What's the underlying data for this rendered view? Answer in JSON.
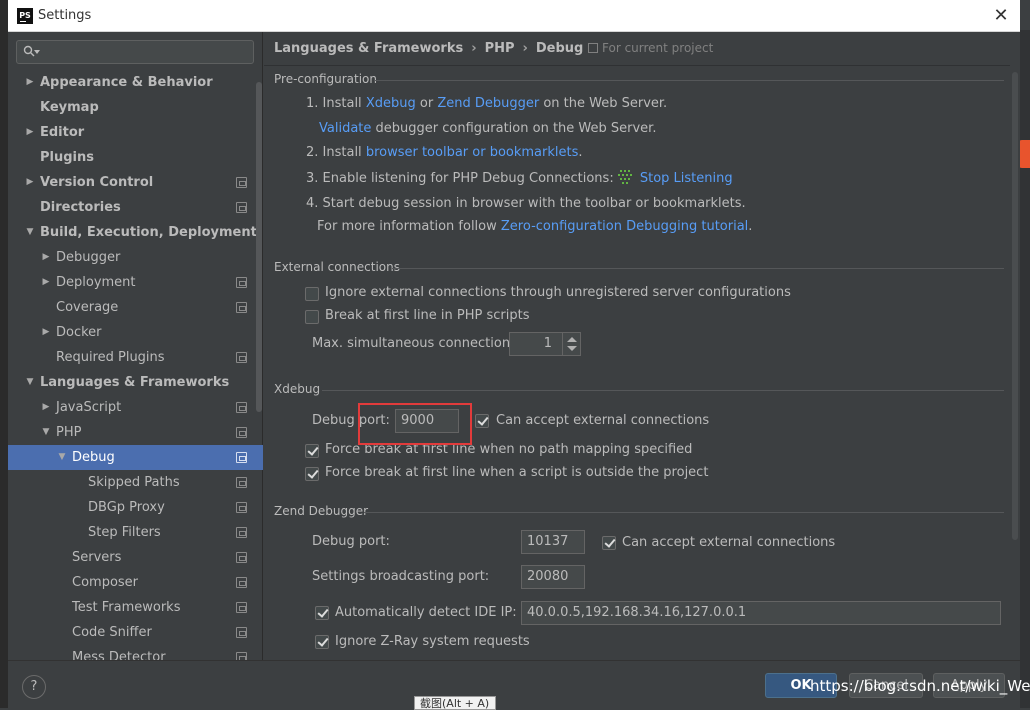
{
  "window": {
    "title": "Settings",
    "app_icon": "PS"
  },
  "search": {
    "placeholder": ""
  },
  "tree": [
    {
      "label": "Appearance & Behavior",
      "bold": true,
      "expander": "right"
    },
    {
      "label": "Keymap",
      "bold": true
    },
    {
      "label": "Editor",
      "bold": true,
      "expander": "right"
    },
    {
      "label": "Plugins",
      "bold": true
    },
    {
      "label": "Version Control",
      "bold": true,
      "expander": "right",
      "project": true
    },
    {
      "label": "Directories",
      "bold": true,
      "project": true
    },
    {
      "label": "Build, Execution, Deployment",
      "bold": true,
      "expander": "down"
    },
    {
      "label": "Debugger",
      "expander": "right"
    },
    {
      "label": "Deployment",
      "expander": "right",
      "project": true
    },
    {
      "label": "Coverage",
      "project": true
    },
    {
      "label": "Docker",
      "expander": "right"
    },
    {
      "label": "Required Plugins",
      "project": true
    },
    {
      "label": "Languages & Frameworks",
      "bold": true,
      "expander": "down"
    },
    {
      "label": "JavaScript",
      "expander": "right",
      "project": true
    },
    {
      "label": "PHP",
      "expander": "down",
      "project": true
    },
    {
      "label": "Debug",
      "expander": "down",
      "project": true,
      "selected": true
    },
    {
      "label": "Skipped Paths",
      "project": true
    },
    {
      "label": "DBGp Proxy",
      "project": true
    },
    {
      "label": "Step Filters",
      "project": true
    },
    {
      "label": "Servers",
      "project": true
    },
    {
      "label": "Composer",
      "project": true
    },
    {
      "label": "Test Frameworks",
      "project": true
    },
    {
      "label": "Code Sniffer",
      "project": true
    },
    {
      "label": "Mess Detector",
      "project": true
    }
  ],
  "breadcrumb": {
    "items": [
      "Languages & Frameworks",
      "PHP",
      "Debug"
    ],
    "separator": "›",
    "scope": "For current project"
  },
  "preconfig": {
    "title": "Pre-configuration",
    "step1_num": "1. Install",
    "xdebug": "Xdebug",
    "or": "or",
    "zend_debugger": "Zend Debugger",
    "on_server": "on the Web Server.",
    "validate": "Validate",
    "validate_rest": "debugger configuration on the Web Server.",
    "step2_num": "2. Install",
    "browser_toolbar": "browser toolbar or bookmarklets",
    "step2_dot": ".",
    "step3": "3. Enable listening for PHP Debug Connections:",
    "stop_listening": "Stop Listening",
    "step4": "4. Start debug session in browser with the toolbar or bookmarklets.",
    "more_info": "For more information follow",
    "tutorial": "Zero-configuration Debugging tutorial",
    "tutorial_dot": "."
  },
  "external": {
    "title": "External connections",
    "ignore_label": "Ignore external connections through unregistered server configurations",
    "ignore_checked": false,
    "break_label": "Break at first line in PHP scripts",
    "break_checked": false,
    "max_label": "Max. simultaneous connections:",
    "max_value": "1"
  },
  "xdebug": {
    "title": "Xdebug",
    "port_label": "Debug port:",
    "port_value": "9000",
    "accept_label": "Can accept external connections",
    "accept_checked": true,
    "force1_label": "Force break at first line when no path mapping specified",
    "force1_checked": true,
    "force2_label": "Force break at first line when a script is outside the project",
    "force2_checked": true
  },
  "zend": {
    "title": "Zend Debugger",
    "port_label": "Debug port:",
    "port_value": "10137",
    "accept_label": "Can accept external connections",
    "accept_checked": true,
    "broadcast_label": "Settings broadcasting port:",
    "broadcast_value": "20080",
    "auto_label": "Automatically detect IDE IP:",
    "auto_checked": true,
    "auto_value": "40.0.0.5,192.168.34.16,127.0.0.1",
    "zray_label": "Ignore Z-Ray system requests",
    "zray_checked": true
  },
  "buttons": {
    "help": "?",
    "ok": "OK",
    "cancel": "Cancel",
    "apply": "Apply"
  },
  "overlay": {
    "watermark": "https://blog.csdn.net/wiki_Wei",
    "tooltip": "截图(Alt + A)"
  },
  "colors": {
    "accent": "#4b6eaf",
    "link": "#589df6",
    "highlight_box": "#e23b3b"
  }
}
